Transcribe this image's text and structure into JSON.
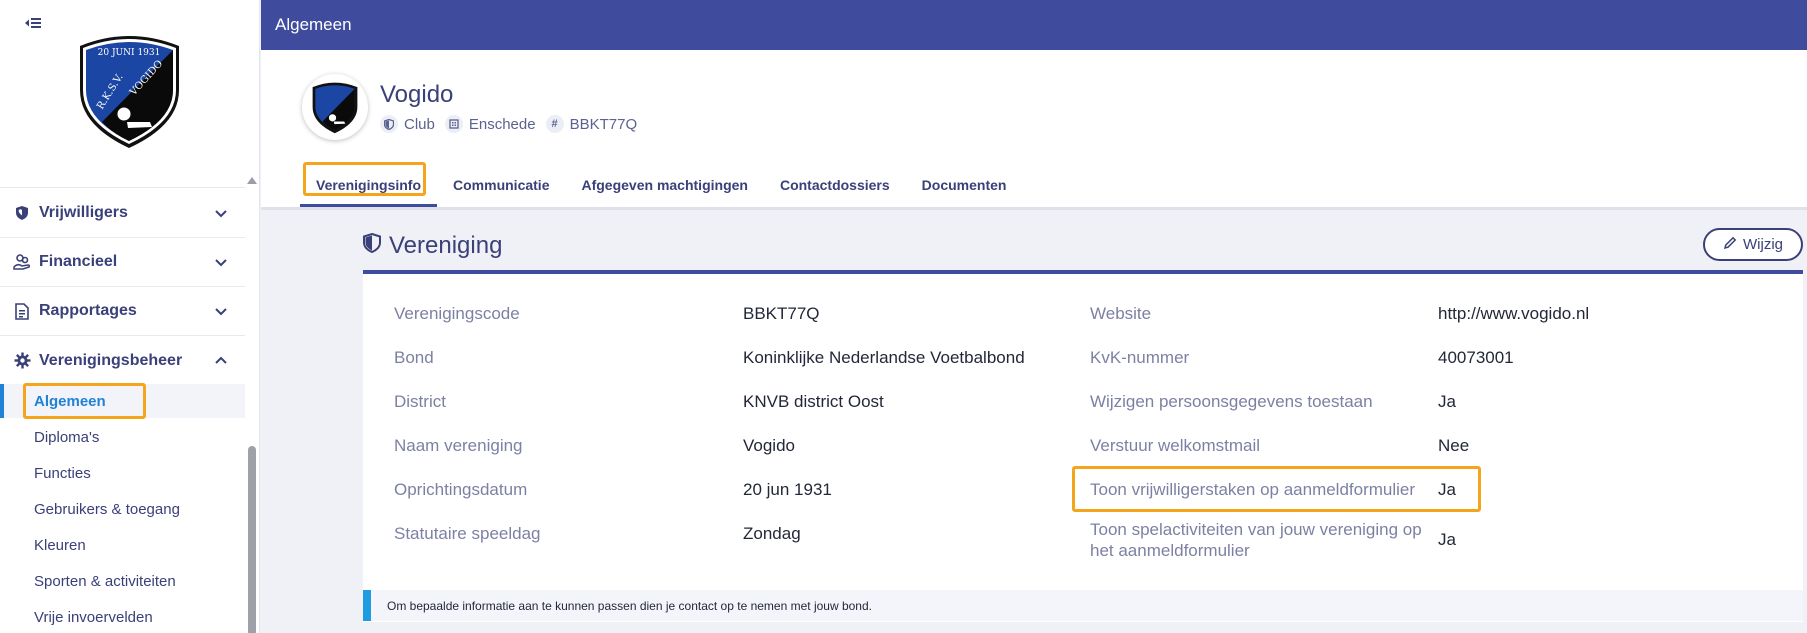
{
  "sidebar": {
    "sections": [
      {
        "label": "Vrijwilligers",
        "icon": "shield-heart-icon"
      },
      {
        "label": "Financieel",
        "icon": "hand-coins-icon"
      },
      {
        "label": "Rapportages",
        "icon": "report-icon"
      },
      {
        "label": "Verenigingsbeheer",
        "icon": "gear-icon"
      }
    ],
    "items": [
      "Algemeen",
      "Diploma's",
      "Functies",
      "Gebruikers & toegang",
      "Kleuren",
      "Sporten & activiteiten",
      "Vrije invoervelden"
    ],
    "logo_text": {
      "date": "20 JUNI 1931",
      "left": "R.K.S.V.",
      "right": "VOGIDO"
    }
  },
  "topbar": {
    "title": "Algemeen"
  },
  "header": {
    "name": "Vogido",
    "meta": [
      {
        "text": "Club",
        "icon": "shield-icon"
      },
      {
        "text": "Enschede",
        "icon": "building-icon"
      },
      {
        "text": "BBKT77Q",
        "icon": "hash-icon"
      }
    ],
    "tabs": [
      "Verenigingsinfo",
      "Communicatie",
      "Afgegeven machtigingen",
      "Contactdossiers",
      "Documenten"
    ]
  },
  "card": {
    "title": "Vereniging",
    "edit_label": "Wijzig",
    "left": [
      {
        "label": "Verenigingscode",
        "value": "BBKT77Q"
      },
      {
        "label": "Bond",
        "value": "Koninklijke Nederlandse Voetbalbond"
      },
      {
        "label": "District",
        "value": "KNVB district Oost"
      },
      {
        "label": "Naam vereniging",
        "value": "Vogido"
      },
      {
        "label": "Oprichtingsdatum",
        "value": "20 jun 1931"
      },
      {
        "label": "Statutaire speeldag",
        "value": "Zondag"
      }
    ],
    "right": [
      {
        "label": "Website",
        "value": "http://www.vogido.nl"
      },
      {
        "label": "KvK-nummer",
        "value": "40073001"
      },
      {
        "label": "Wijzigen persoonsgegevens toestaan",
        "value": "Ja"
      },
      {
        "label": "Verstuur welkomstmail",
        "value": "Nee"
      },
      {
        "label": "Toon vrijwilligerstaken op aanmeldformulier",
        "value": "Ja"
      },
      {
        "label_line1": "Toon spelactiviteiten van jouw vereniging op",
        "label_line2": "het aanmeldformulier",
        "value": "Ja"
      }
    ],
    "notice": "Om bepaalde informatie aan te kunnen passen dien je contact op te nemen met jouw bond."
  },
  "colors": {
    "primary": "#3f4b9d",
    "accent": "#1f82d6",
    "highlight": "#f4a51c"
  }
}
